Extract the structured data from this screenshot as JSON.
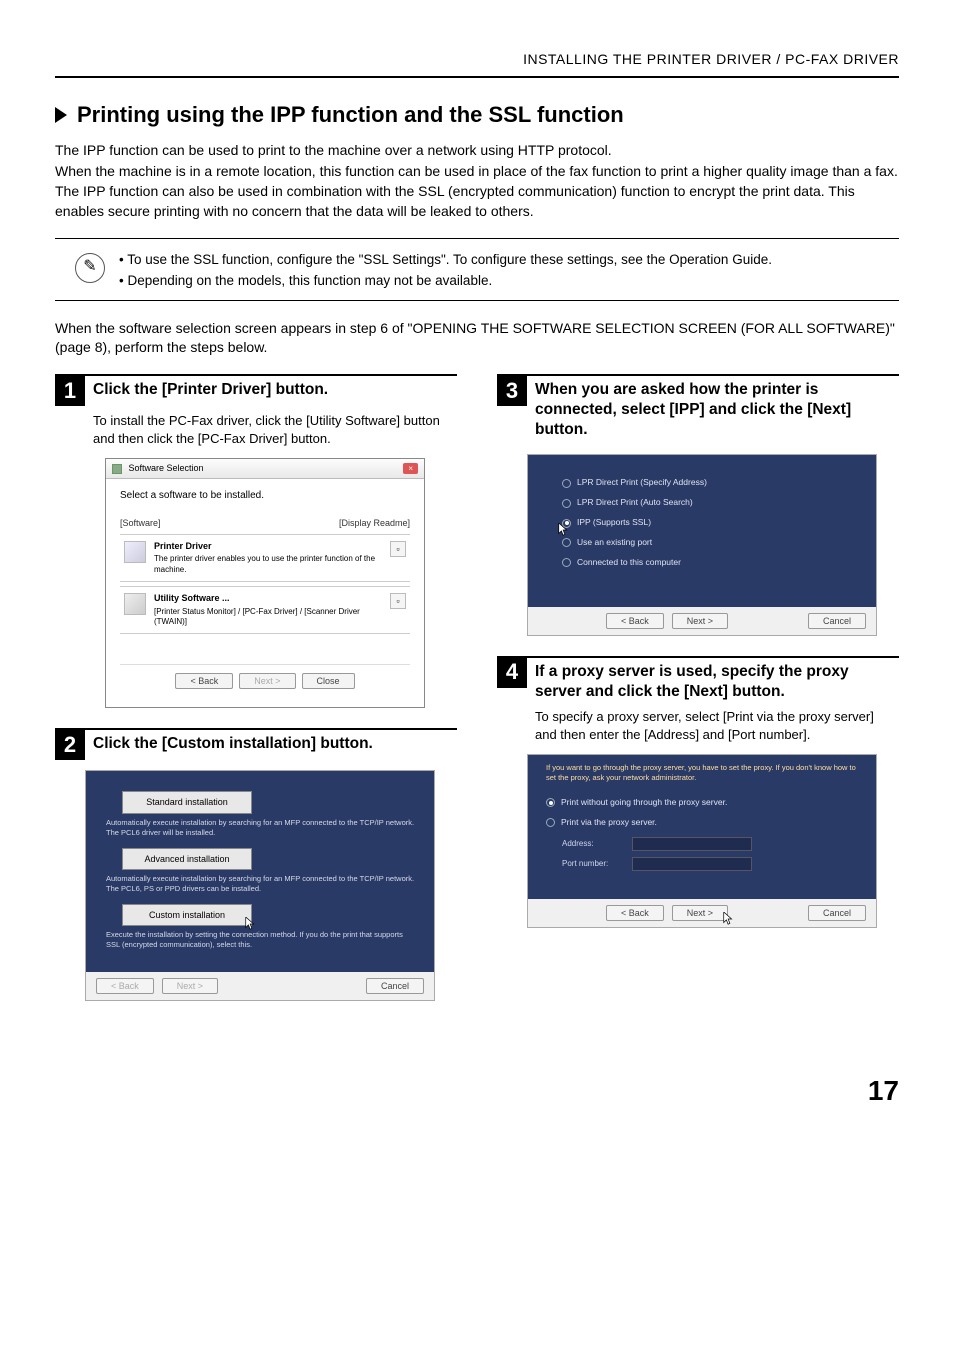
{
  "header": "INSTALLING THE PRINTER DRIVER / PC-FAX DRIVER",
  "title": "Printing using the IPP function and the SSL function",
  "intro": "The IPP function can be used to print to the machine over a network using HTTP protocol.\nWhen the machine is in a remote location, this function can be used in place of the fax function to print a higher quality image than a fax. The IPP function can also be used in combination with the SSL (encrypted communication) function to encrypt the print data. This enables secure printing with no concern that the data will be leaked to others.",
  "notes": {
    "line1": "• To use the SSL function, configure the \"SSL Settings\". To configure these settings, see the Operation Guide.",
    "line2": "• Depending on the models, this function may not be available."
  },
  "lead": "When the software selection screen appears in step 6 of \"OPENING THE SOFTWARE SELECTION SCREEN (FOR ALL SOFTWARE)\" (page 8), perform the steps below.",
  "steps": {
    "s1": {
      "num": "1",
      "title": "Click the [Printer Driver] button.",
      "body": "To install the PC-Fax driver, click the [Utility Software] button and then click the [PC-Fax Driver] button."
    },
    "s2": {
      "num": "2",
      "title": "Click the [Custom installation] button."
    },
    "s3": {
      "num": "3",
      "title": "When you are asked how the printer is connected, select [IPP] and click the [Next] button."
    },
    "s4": {
      "num": "4",
      "title": "If a proxy server is used, specify the proxy server and click the [Next] button.",
      "body": "To specify a proxy server, select [Print via the proxy server] and then enter the [Address] and [Port number]."
    }
  },
  "dlg1": {
    "title": "Software Selection",
    "heading": "Select a software to be installed.",
    "col_software": "[Software]",
    "col_readme": "[Display Readme]",
    "item1_title": "Printer Driver",
    "item1_desc": "The printer driver enables you to use the printer function of the machine.",
    "item2_title": "Utility Software ...",
    "item2_desc": "[Printer Status Monitor] / [PC-Fax Driver] / [Scanner Driver (TWAIN)]",
    "btn_back": "< Back",
    "btn_next": "Next >",
    "btn_close": "Close"
  },
  "panel2": {
    "btn1": "Standard installation",
    "desc1": "Automatically execute installation by searching for an MFP connected to the TCP/IP network. The PCL6 driver will be installed.",
    "btn2": "Advanced installation",
    "desc2": "Automatically execute installation by searching for an MFP connected to the TCP/IP network. The PCL6, PS or PPD drivers can be installed.",
    "btn3": "Custom installation",
    "desc3": "Execute the installation by setting the connection method. If you do the print that supports SSL (encrypted communication), select this.",
    "btn_back": "< Back",
    "btn_next": "Next >",
    "btn_cancel": "Cancel"
  },
  "panel3": {
    "opt1": "LPR Direct Print (Specify Address)",
    "opt2": "LPR Direct Print (Auto Search)",
    "opt3": "IPP (Supports SSL)",
    "opt4": "Use an existing port",
    "opt5": "Connected to this computer",
    "btn_back": "< Back",
    "btn_next": "Next >",
    "btn_cancel": "Cancel"
  },
  "panel4": {
    "help": "If you want to go through the proxy server, you have to set the proxy. If you don't know how to set the proxy, ask your network administrator.",
    "opt1": "Print without going through the proxy server.",
    "opt2": "Print via the proxy server.",
    "addr_label": "Address:",
    "port_label": "Port number:",
    "btn_back": "< Back",
    "btn_next": "Next >",
    "btn_cancel": "Cancel"
  },
  "page_number": "17"
}
